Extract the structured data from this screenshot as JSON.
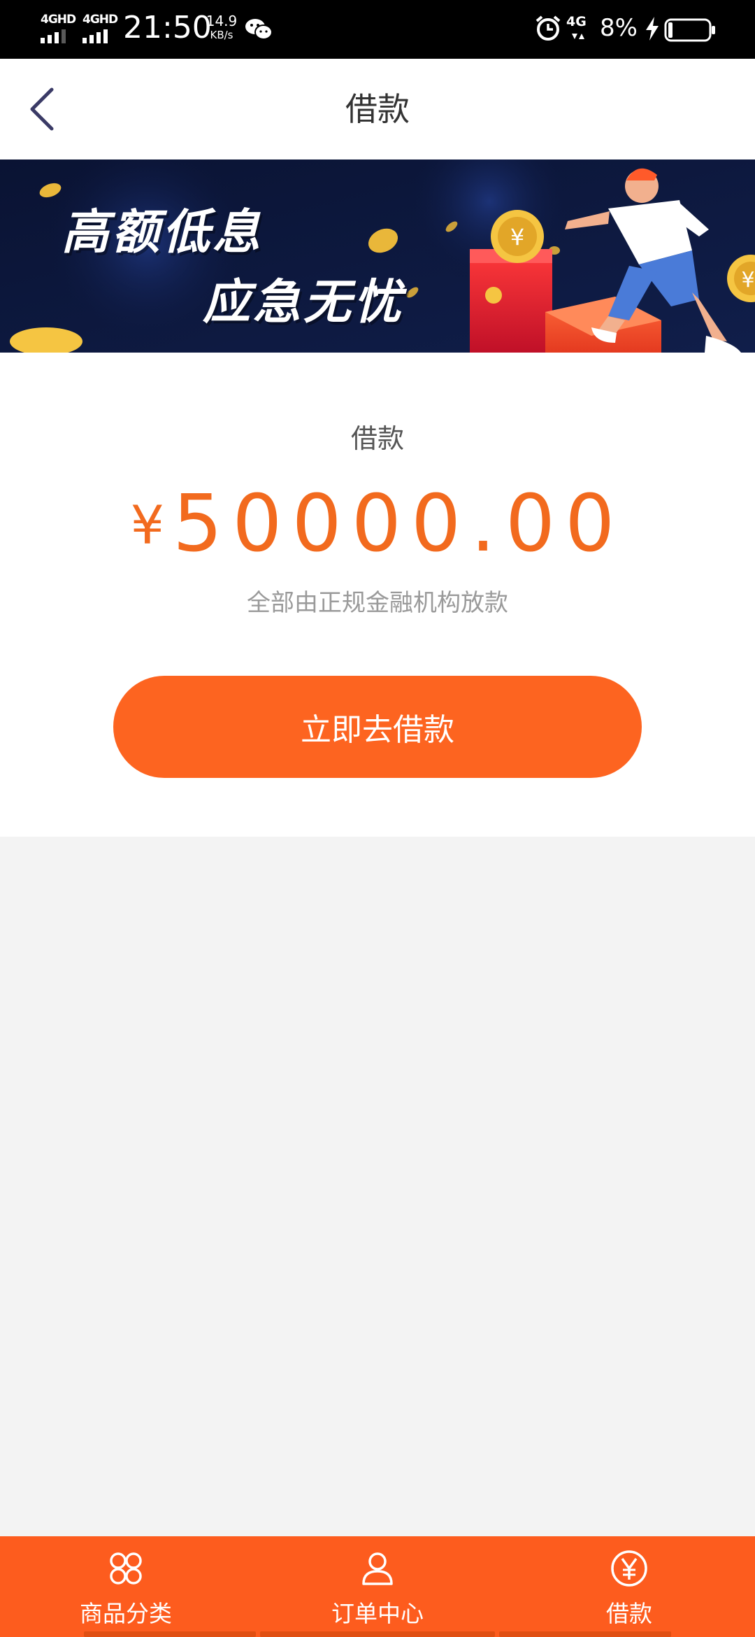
{
  "status_bar": {
    "sim1_label": "4GHD",
    "sim2_label": "4GHD",
    "time": "21:50",
    "speed_value": "14.9",
    "speed_unit": "KB/s",
    "network_label": "4G",
    "battery_percent": "8%",
    "battery_level": 0.08,
    "icons": [
      "signal-icon",
      "wechat-icon",
      "alarm-icon",
      "mobile-data-icon",
      "charging-bolt-icon",
      "battery-icon"
    ]
  },
  "nav": {
    "title": "借款",
    "back_icon": "chevron-left-icon"
  },
  "banner": {
    "line1": "高额低息",
    "line2": "应急无忧"
  },
  "loan": {
    "label": "借款",
    "currency": "¥",
    "amount": "50000.00",
    "note": "全部由正规金融机构放款",
    "button_label": "立即去借款"
  },
  "tabs": [
    {
      "label": "商品分类",
      "icon": "category-grid-icon"
    },
    {
      "label": "订单中心",
      "icon": "user-icon"
    },
    {
      "label": "借款",
      "icon": "yuan-circle-icon",
      "active": true
    }
  ],
  "colors": {
    "accent": "#fd6420",
    "amount": "#f26a1e",
    "tabbar": "#fd5c1e",
    "banner_bg": "#0b1538",
    "page_bg": "#f3f3f3"
  }
}
